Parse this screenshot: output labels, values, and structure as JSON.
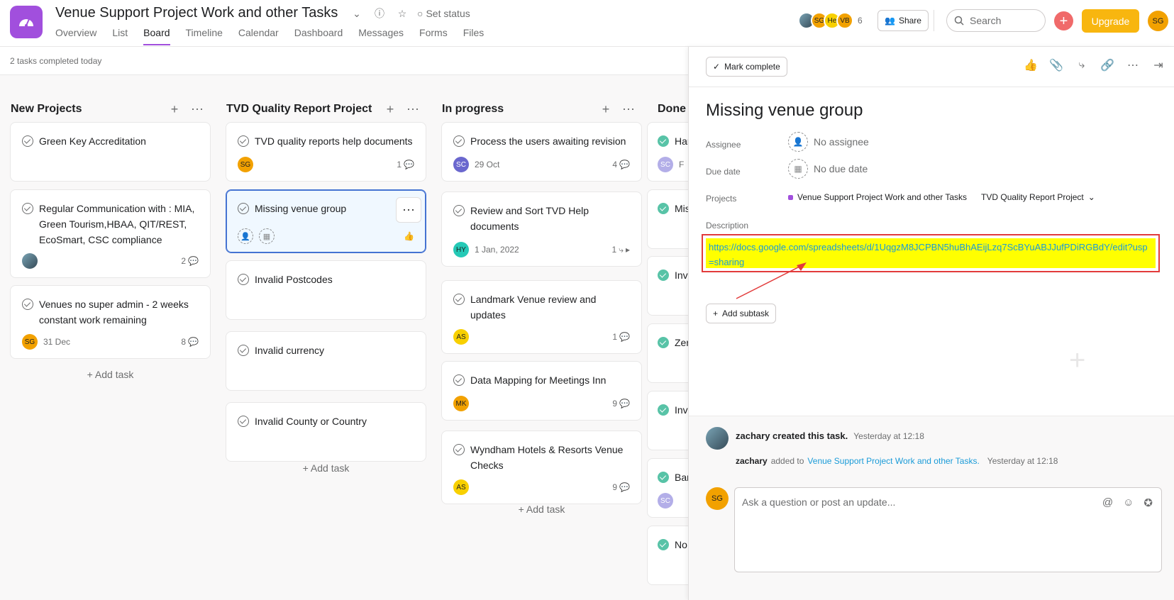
{
  "header": {
    "project_title": "Venue Support Project Work and other Tasks",
    "set_status": "Set status",
    "tabs": [
      "Overview",
      "List",
      "Board",
      "Timeline",
      "Calendar",
      "Dashboard",
      "Messages",
      "Forms",
      "Files"
    ],
    "active_tab": "Board",
    "members": [
      {
        "initials": "",
        "color": "#4a6a7a"
      },
      {
        "initials": "SG",
        "color": "#f2a100"
      },
      {
        "initials": "He",
        "color": "#f8d000"
      },
      {
        "initials": "VB",
        "color": "#f2a100"
      }
    ],
    "member_count": "6",
    "share_label": "Share",
    "search_placeholder": "Search",
    "upgrade_label": "Upgrade",
    "me_initials": "SG"
  },
  "subbar": {
    "text": "2 tasks completed today"
  },
  "board": {
    "add_task_label": "+ Add task",
    "columns": [
      {
        "title": "New Projects",
        "cards": [
          {
            "title": "Green Key Accreditation"
          },
          {
            "title": "Regular Communication with : MIA, Green Tourism,HBAA, QIT/REST, EcoSmart, CSC compliance",
            "comments": "2"
          },
          {
            "title": "Venues no super admin - 2 weeks constant work remaining",
            "assignee": "SG",
            "due": "31 Dec",
            "comments": "8"
          }
        ]
      },
      {
        "title": "TVD Quality Report Project",
        "cards": [
          {
            "title": "TVD quality reports help documents",
            "assignee": "SG",
            "comments": "1"
          },
          {
            "title": "Missing venue group"
          },
          {
            "title": "Invalid Postcodes"
          },
          {
            "title": "Invalid currency"
          },
          {
            "title": "Invalid County or Country"
          }
        ]
      },
      {
        "title": "In progress",
        "cards": [
          {
            "title": "Process the users awaiting revision",
            "assignee": "SC",
            "due": "29 Oct",
            "comments": "4"
          },
          {
            "title": "Review and Sort TVD Help documents",
            "assignee": "HY",
            "due": "1 Jan, 2022",
            "subtasks": "1"
          },
          {
            "title": "Landmark Venue review and updates",
            "assignee": "AS",
            "comments": "1"
          },
          {
            "title": "Data Mapping for Meetings Inn",
            "assignee": "MK",
            "comments": "9"
          },
          {
            "title": "Wyndham Hotels & Resorts Venue Checks",
            "assignee": "AS",
            "comments": "9"
          }
        ]
      },
      {
        "title": "Done",
        "cards": [
          {
            "title": "Har",
            "assignee": "SC",
            "due": "F"
          },
          {
            "title": "Mis"
          },
          {
            "title": "Inv"
          },
          {
            "title": "Zer"
          },
          {
            "title": "Inv"
          },
          {
            "title": "Bar",
            "assignee": "SC"
          },
          {
            "title": "No"
          }
        ]
      }
    ]
  },
  "detail": {
    "mark_complete": "Mark complete",
    "task_name": "Missing venue group",
    "labels": {
      "assignee": "Assignee",
      "due_date": "Due date",
      "projects": "Projects",
      "description": "Description"
    },
    "assignee_value": "No assignee",
    "due_value": "No due date",
    "project_1": "Venue Support Project Work and other Tasks",
    "project_2": "TVD Quality Report Project",
    "description_link": "https://docs.google.com/spreadsheets/d/1UqgzM8JCPBN5huBhAEijLzq7ScBYuABJJufPDiRGBdY/edit?usp=sharing",
    "add_subtask": "Add subtask",
    "activity": {
      "creator": "zachary created this task.",
      "created_time": "Yesterday at 12:18",
      "added_user": "zachary",
      "added_text": "added to",
      "added_project": "Venue Support Project Work and other Tasks.",
      "added_time": "Yesterday at 12:18"
    },
    "comment_placeholder": "Ask a question or post an update...",
    "commenter_initials": "SG"
  },
  "colors": {
    "brand": "#a14fdd",
    "upgrade": "#f8b60f",
    "highlight": "#ffff00",
    "link": "#1a9bd8",
    "annotation": "#e23b3b"
  }
}
